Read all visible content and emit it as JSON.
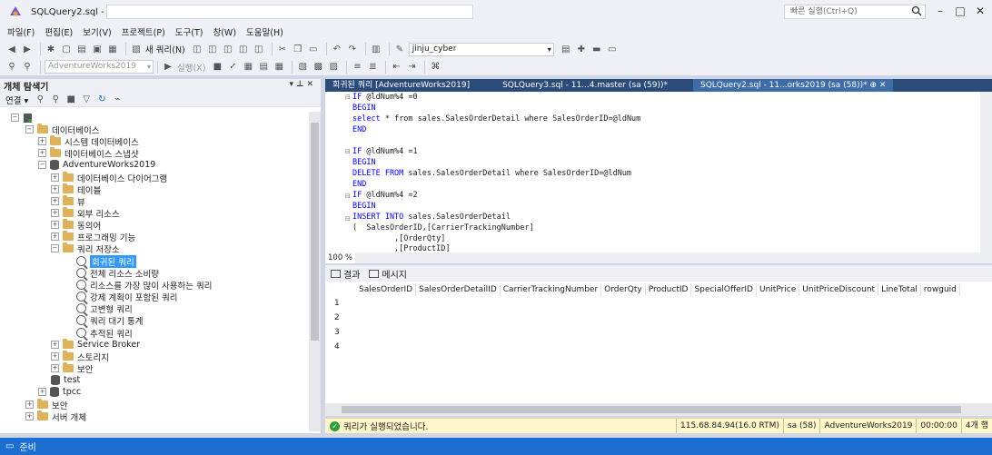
{
  "window": {
    "title": "SQLQuery2.sql -",
    "quick_launch_placeholder": "빠른 실행(Ctrl+Q)",
    "minimize": "–",
    "maximize": "□",
    "close": "✕"
  },
  "menu": [
    "파일(F)",
    "편집(E)",
    "보기(V)",
    "프로젝트(P)",
    "도구(T)",
    "창(W)",
    "도움말(H)"
  ],
  "toolbar": {
    "new_query_label": "새 쿼리(N)",
    "database_combo": "jinju_cyber",
    "db_selector": "AdventureWorks2019",
    "execute_label": "실행(X)"
  },
  "object_explorer": {
    "title": "개체 탐색기",
    "connect_label": "연결 ▾",
    "pin_controls": "▾ ⊥ ✕",
    "nodes": [
      {
        "label": "데이터베이스"
      },
      {
        "label": "시스템 데이터베이스"
      },
      {
        "label": "데이터베이스 스냅샷"
      },
      {
        "label": "AdventureWorks2019"
      },
      {
        "label": "데이터베이스 다이어그램"
      },
      {
        "label": "테이블"
      },
      {
        "label": "뷰"
      },
      {
        "label": "외부 리소스"
      },
      {
        "label": "동의어"
      },
      {
        "label": "프로그래밍 기능"
      },
      {
        "label": "쿼리 저장소"
      },
      {
        "label": "회귀된 쿼리"
      },
      {
        "label": "전체 리소스 소비량"
      },
      {
        "label": "리소스를 가장 많이 사용하는 쿼리"
      },
      {
        "label": "강제 계획이 포함된 쿼리"
      },
      {
        "label": "고변형 쿼리"
      },
      {
        "label": "쿼리 대기 통계"
      },
      {
        "label": "추적된 쿼리"
      },
      {
        "label": "Service Broker"
      },
      {
        "label": "스토리지"
      },
      {
        "label": "보안"
      },
      {
        "label": "test"
      },
      {
        "label": "tpcc"
      },
      {
        "label": "보안"
      },
      {
        "label": "서버 개체"
      }
    ]
  },
  "tabs": [
    {
      "label": "회귀된 쿼리 [AdventureWorks2019]"
    },
    {
      "label": "SQLQuery3.sql - 11...4.master (sa (59))*"
    },
    {
      "label": "SQLQuery2.sql - 11...orks2019 (sa (58))*  ⊕  ✕"
    }
  ],
  "editor": {
    "lines": [
      {
        "prefix": "IF ",
        "kw": "",
        "rest": "@ldNum%4 =0"
      },
      {
        "prefix": "",
        "kw": "BEGIN",
        "rest": ""
      },
      {
        "prefix": "",
        "kw": "select",
        "rest": " * from sales.SalesOrderDetail where SalesOrderID=@ldNum"
      },
      {
        "prefix": "",
        "kw": "END",
        "rest": ""
      },
      {
        "prefix": "",
        "kw": "",
        "rest": ""
      },
      {
        "prefix": "IF ",
        "kw": "",
        "rest": "@ldNum%4 =1"
      },
      {
        "prefix": "",
        "kw": "BEGIN",
        "rest": ""
      },
      {
        "prefix": "",
        "kw": "DELETE FROM",
        "rest": " sales.SalesOrderDetail where SalesOrderID=@ldNum"
      },
      {
        "prefix": "",
        "kw": "END",
        "rest": ""
      },
      {
        "prefix": "IF ",
        "kw": "",
        "rest": "@ldNum%4 =2"
      },
      {
        "prefix": "",
        "kw": "BEGIN",
        "rest": ""
      },
      {
        "prefix": "",
        "kw": "INSERT INTO",
        "rest": " sales.SalesOrderDetail"
      },
      {
        "prefix": "",
        "kw": "",
        "rest": "(  SalesOrderID,[CarrierTrackingNumber]"
      },
      {
        "prefix": "",
        "kw": "",
        "rest": "         ,[OrderQty]"
      },
      {
        "prefix": "",
        "kw": "",
        "rest": "         ,[ProductID]"
      }
    ],
    "zoom": "100 %"
  },
  "results": {
    "tabs": [
      "결과",
      "메시지"
    ],
    "columns": [
      "SalesOrderID",
      "SalesOrderDetailID",
      "CarrierTrackingNumber",
      "OrderQty",
      "ProductID",
      "SpecialOfferID",
      "UnitPrice",
      "UnitPriceDiscount",
      "LineTotal",
      "rowguid"
    ],
    "rows": [
      "1",
      "2",
      "3",
      "4"
    ]
  },
  "query_status": {
    "message": "쿼리가 실행되었습니다.",
    "server": "115.68.84.94(16.0 RTM)",
    "user": "sa (58)",
    "database": "AdventureWorks2019",
    "elapsed": "00:00:00",
    "rows": "4개 행"
  },
  "status_bar": {
    "text": "준비"
  },
  "colors": {
    "accent": "#1c6fd1",
    "tab_bar": "#2b4b79",
    "selected": "#3399ff",
    "keyword": "#0000ff",
    "status_ok": "#fff7c9"
  }
}
